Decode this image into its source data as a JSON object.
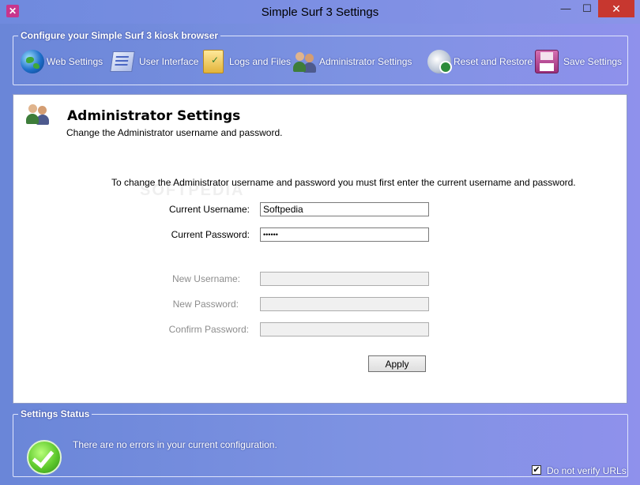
{
  "window": {
    "title": "Simple Surf 3 Settings",
    "minimize": "—",
    "maximize": "☐",
    "close": "✕"
  },
  "toolbar": {
    "group_label": "Configure your Simple Surf 3 kiosk browser",
    "items": [
      {
        "label": "Web Settings",
        "icon": "globe-icon"
      },
      {
        "label": "User Interface",
        "icon": "user-interface-icon"
      },
      {
        "label": "Logs and Files",
        "icon": "folder-icon"
      },
      {
        "label": "Administrator Settings",
        "icon": "users-icon"
      },
      {
        "label": "Reset and Restore",
        "icon": "reset-icon"
      },
      {
        "label": "Save Settings",
        "icon": "save-icon"
      }
    ]
  },
  "panel": {
    "title": "Administrator Settings",
    "subtitle": "Change the Administrator username and password.",
    "instructions": "To change the Administrator username and password you must first enter the current username and password.",
    "watermark": "SOFTPEDIA",
    "current_username_label": "Current Username:",
    "current_username_value": "Softpedia",
    "current_password_label": "Current Password:",
    "current_password_value": "••••••",
    "new_username_label": "New Username:",
    "new_password_label": "New Password:",
    "confirm_password_label": "Confirm Password:",
    "apply_label": "Apply"
  },
  "status": {
    "group_label": "Settings Status",
    "message": "There are no errors in your current configuration.",
    "verify_label": "Do not verify URLs",
    "verify_checked": "✔"
  }
}
